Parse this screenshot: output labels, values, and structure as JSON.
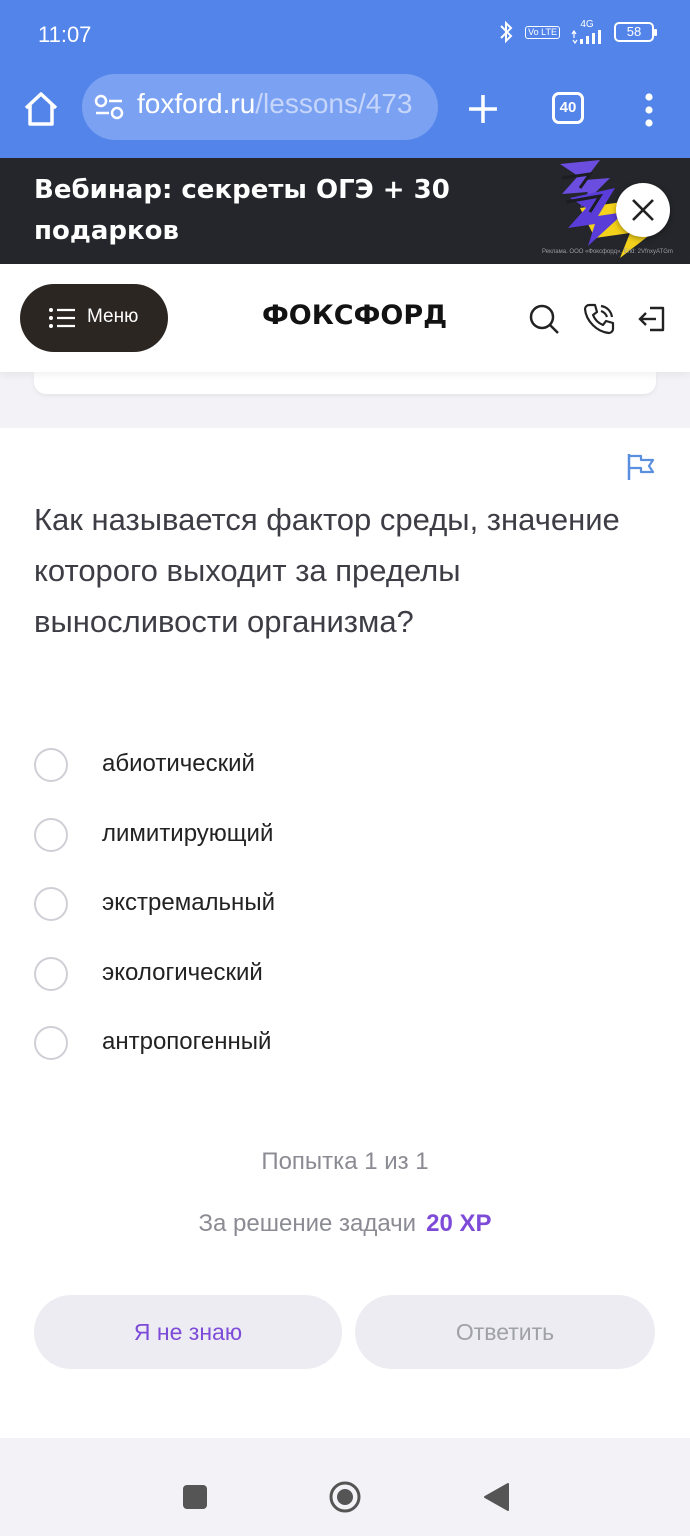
{
  "status_bar": {
    "time": "11:07",
    "network": "4G",
    "volte": "Vo LTE",
    "battery": "58",
    "icons": [
      "bluetooth-icon",
      "signal-icon",
      "battery-icon"
    ]
  },
  "browser": {
    "url_domain": "foxford.ru",
    "url_path": "/lessons/473",
    "tab_count": "40",
    "colors": {
      "toolbar": "#5284ea",
      "urlbar": "#7ba1f2"
    }
  },
  "ad": {
    "title": "Вебинар: секреты ОГЭ + 30 подарков",
    "disclaimer": "Реклама. ООО «Фоксфорд». Erid: 2VfnxyATGm"
  },
  "header": {
    "menu_label": "Меню",
    "logo": "ФОКСФОРД"
  },
  "question": {
    "text": "Как называется фактор среды, значение которого выходит за пределы выносливости организма?"
  },
  "options": [
    {
      "label": "абиотический"
    },
    {
      "label": "лимитирующий"
    },
    {
      "label": "экстремальный"
    },
    {
      "label": "экологический"
    },
    {
      "label": "антропогенный"
    }
  ],
  "attempt": {
    "text": "Попытка 1 из 1"
  },
  "reward": {
    "text": "За решение задачи",
    "xp": "20 XP"
  },
  "buttons": {
    "dont_know": "Я не знаю",
    "answer": "Ответить"
  },
  "accent_color": "#7d4bd8"
}
